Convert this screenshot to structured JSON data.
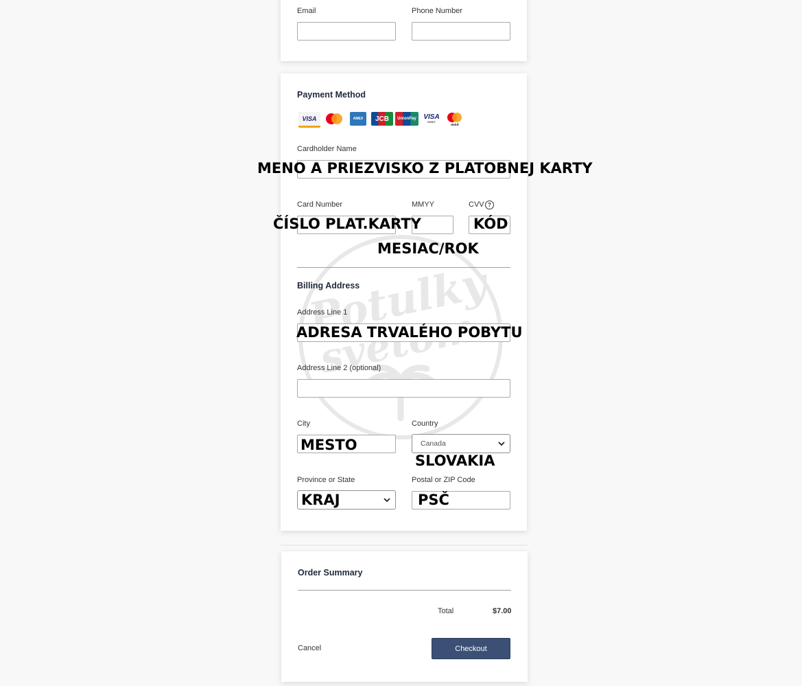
{
  "contact": {
    "email_label": "Email",
    "email_value": "",
    "phone_label": "Phone Number",
    "phone_value": ""
  },
  "payment": {
    "title": "Payment Method",
    "card_logos": [
      "VISA",
      "mastercard",
      "AMERICAN EXPRESS",
      "JCB",
      "UnionPay 银联",
      "VISA DEBIT",
      "mastercard debit"
    ],
    "cardholder_label": "Cardholder Name",
    "card_number_label": "Card Number",
    "mmyy_label": "MMYY",
    "cvv_label": "CVV",
    "cvv_help_icon": "?",
    "billing_title": "Billing Address",
    "address1_label": "Address Line 1",
    "address2_label": "Address Line 2 (optional)",
    "city_label": "City",
    "country_label": "Country",
    "country_selected": "Canada",
    "province_label": "Province or State",
    "postal_label": "Postal or ZIP Code"
  },
  "overlay": {
    "cardholder": "MENO A PRIEZVISKO Z PLATOBNEJ KARTY",
    "card_number": "ČÍSLO PLAT.KARTY",
    "cvv": "KÓD",
    "mmyy": "MESIAC/ROK",
    "address1": "ADRESA TRVALÉHO POBYTU",
    "city": "MESTO",
    "country": "SLOVAKIA",
    "province": "KRAJ",
    "postal": "PSČ"
  },
  "watermark_brand": "Potulky svetom",
  "summary": {
    "title": "Order Summary",
    "total_label": "Total",
    "total_value": "$7.00",
    "cancel_label": "Cancel",
    "checkout_label": "Checkout"
  },
  "colors": {
    "checkout_button": "#3b5074",
    "background": "#f8f8f8"
  }
}
